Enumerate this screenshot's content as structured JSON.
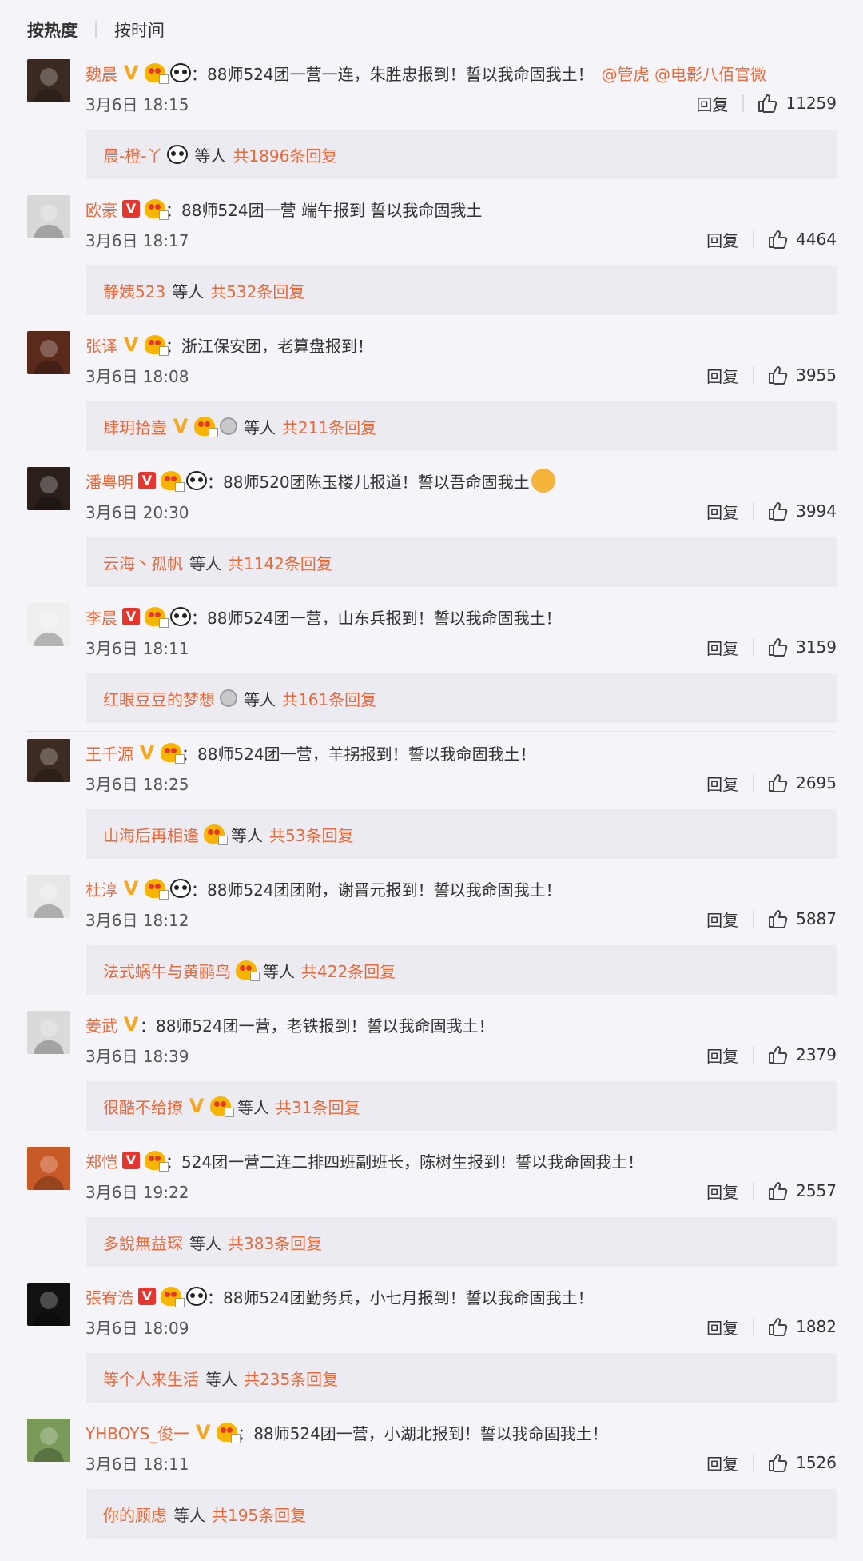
{
  "tabs": [
    "按热度",
    "按时间"
  ],
  "comments": [
    {
      "user": "魏晨",
      "text": "88师524团一营一连，朱胜忠报到！誓以我命固我土！",
      "mentions": "@管虎 @电影八佰官微",
      "time": "3月6日 18:15",
      "reply": "回复",
      "likes": "11259",
      "reply_user": "晨-橙-丫",
      "reply_mid": "等人",
      "reply_count": "共1896条回复",
      "badges": [
        "v-orange",
        "medal",
        "panda"
      ],
      "reply_badges": [
        "panda"
      ],
      "avatar_color": "#3a2a22"
    },
    {
      "user": "欧豪",
      "text": "88师524团一营 端午报到 誓以我命固我土",
      "time": "3月6日 18:17",
      "reply": "回复",
      "likes": "4464",
      "reply_user": "静姨523",
      "reply_mid": "等人",
      "reply_count": "共532条回复",
      "badges": [
        "v-red",
        "medal"
      ],
      "reply_badges": [],
      "avatar_color": "#d8d8d8"
    },
    {
      "user": "张译",
      "text": "浙江保安团，老算盘报到！",
      "time": "3月6日 18:08",
      "reply": "回复",
      "likes": "3955",
      "reply_user": "肆玥拾壹",
      "reply_mid": "等人",
      "reply_count": "共211条回复",
      "badges": [
        "v-orange",
        "medal"
      ],
      "reply_badges": [
        "v-orange",
        "medal",
        "silver"
      ],
      "avatar_color": "#5a2a1c"
    },
    {
      "user": "潘粤明",
      "text": "88师520团陈玉楼儿报道！誓以吾命固我土",
      "time": "3月6日 20:30",
      "reply": "回复",
      "likes": "3994",
      "reply_user": "云海丶孤帆",
      "reply_mid": "等人",
      "reply_count": "共1142条回复",
      "badges": [
        "v-red",
        "medal",
        "panda"
      ],
      "reply_badges": [],
      "fist": true,
      "avatar_color": "#2a1f1a"
    },
    {
      "user": "李晨",
      "text": "88师524团一营，山东兵报到！誓以我命固我土！",
      "time": "3月6日 18:11",
      "reply": "回复",
      "likes": "3159",
      "reply_user": "红眼豆豆的梦想",
      "reply_mid": "等人",
      "reply_count": "共161条回复",
      "badges": [
        "v-red",
        "medal",
        "panda"
      ],
      "reply_badges": [
        "silver"
      ],
      "avatar_color": "#efefef"
    },
    {
      "user": "王千源",
      "text": "88师524团一营，羊拐报到！誓以我命固我土！",
      "time": "3月6日 18:25",
      "reply": "回复",
      "likes": "2695",
      "reply_user": "山海后再相逢",
      "reply_mid": "等人",
      "reply_count": "共53条回复",
      "badges": [
        "v-orange",
        "medal"
      ],
      "reply_badges": [
        "medal"
      ],
      "avatar_color": "#3b2b22"
    },
    {
      "user": "杜淳",
      "text": "88师524团团附，谢晋元报到！誓以我命固我土！",
      "time": "3月6日 18:12",
      "reply": "回复",
      "likes": "5887",
      "reply_user": "法式蜗牛与黄鹂鸟",
      "reply_mid": "等人",
      "reply_count": "共422条回复",
      "badges": [
        "v-orange",
        "medal",
        "panda"
      ],
      "reply_badges": [
        "medal"
      ],
      "avatar_color": "#e8e8e8"
    },
    {
      "user": "姜武",
      "text": "88师524团一营，老铁报到！誓以我命固我土！",
      "time": "3月6日 18:39",
      "reply": "回复",
      "likes": "2379",
      "reply_user": "很酷不给撩",
      "reply_mid": "等人",
      "reply_count": "共31条回复",
      "badges": [
        "v-orange"
      ],
      "reply_badges": [
        "v-orange",
        "medal"
      ],
      "avatar_color": "#dadada"
    },
    {
      "user": "郑恺",
      "text": "524团一营二连二排四班副班长，陈树生报到！誓以我命固我土！",
      "time": "3月6日 19:22",
      "reply": "回复",
      "likes": "2557",
      "reply_user": "多說無益琛",
      "reply_mid": "等人",
      "reply_count": "共383条回复",
      "badges": [
        "v-red",
        "medal"
      ],
      "reply_badges": [],
      "avatar_color": "#c85a28"
    },
    {
      "user": "張宥浩",
      "text": "88师524团勤务兵，小七月报到！誓以我命固我土！",
      "time": "3月6日 18:09",
      "reply": "回复",
      "likes": "1882",
      "reply_user": "等个人来生活",
      "reply_mid": "等人",
      "reply_count": "共235条回复",
      "badges": [
        "v-red",
        "medal",
        "panda"
      ],
      "reply_badges": [],
      "avatar_color": "#111111"
    },
    {
      "user": "YHBOYS_俊一",
      "text": "88师524团一营，小湖北报到！誓以我命固我土！",
      "time": "3月6日 18:11",
      "reply": "回复",
      "likes": "1526",
      "reply_user": "你的顾虑",
      "reply_mid": "等人",
      "reply_count": "共195条回复",
      "badges": [
        "v-orange",
        "medal"
      ],
      "reply_badges": [],
      "avatar_color": "#7a9a5a"
    }
  ]
}
